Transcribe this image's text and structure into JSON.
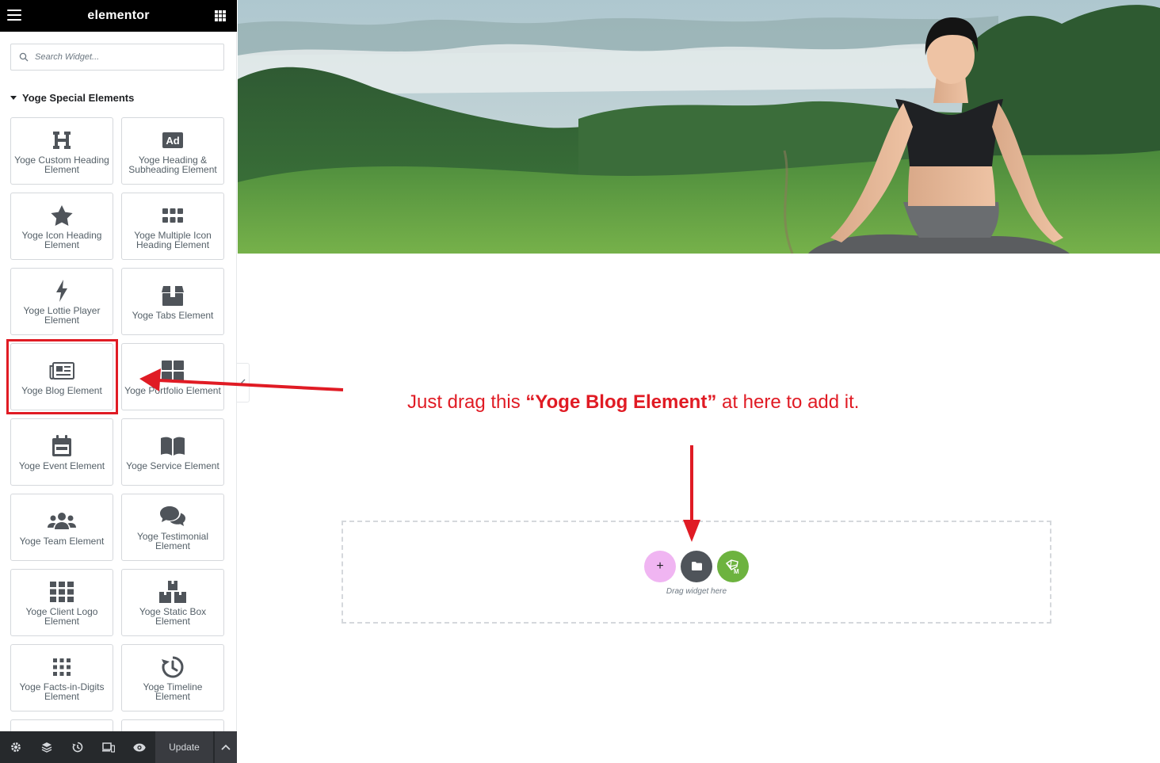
{
  "app": {
    "logo": "elementor"
  },
  "search": {
    "placeholder": "Search Widget..."
  },
  "category": {
    "title": "Yoge Special Elements"
  },
  "widgets": [
    {
      "label": "Yoge Custom Heading Element",
      "icon": "heading-icon"
    },
    {
      "label": "Yoge Heading & Subheading Element",
      "icon": "ad-icon"
    },
    {
      "label": "Yoge Icon Heading Element",
      "icon": "star-icon"
    },
    {
      "label": "Yoge Multiple Icon Heading Element",
      "icon": "multi-dots-icon"
    },
    {
      "label": "Yoge Lottie Player Element",
      "icon": "bolt-icon"
    },
    {
      "label": "Yoge Tabs Element",
      "icon": "box-icon"
    },
    {
      "label": "Yoge Blog Element",
      "icon": "newspaper-icon",
      "highlighted": true
    },
    {
      "label": "Yoge Portfolio Element",
      "icon": "grid-tiles-icon"
    },
    {
      "label": "Yoge Event Element",
      "icon": "calendar-icon"
    },
    {
      "label": "Yoge Service Element",
      "icon": "book-open-icon"
    },
    {
      "label": "Yoge Team Element",
      "icon": "users-icon"
    },
    {
      "label": "Yoge Testimonial Element",
      "icon": "comments-icon"
    },
    {
      "label": "Yoge Client Logo Element",
      "icon": "th-grid-icon"
    },
    {
      "label": "Yoge Static Box Element",
      "icon": "boxes-icon"
    },
    {
      "label": "Yoge Facts-in-Digits Element",
      "icon": "dots-grid-icon"
    },
    {
      "label": "Yoge Timeline Element",
      "icon": "history-icon"
    }
  ],
  "bottombar": {
    "icons": [
      "settings-icon",
      "layers-icon",
      "history-icon",
      "responsive-icon",
      "preview-icon"
    ],
    "update_label": "Update"
  },
  "canvas": {
    "instruction_before": "Just drag this ",
    "instruction_bold": "“Yoge Blog Element”",
    "instruction_after": " at here to add it.",
    "dropzone_text": "Drag widget here",
    "add_label": "+"
  },
  "colors": {
    "annotation_red": "#e01b24",
    "add_button": "#f0b5f2",
    "folder_button": "#4f545a",
    "envato_button": "#6db33f",
    "widget_icon": "#4f545a",
    "widget_text": "#556068",
    "bottombar": "#26292c"
  }
}
